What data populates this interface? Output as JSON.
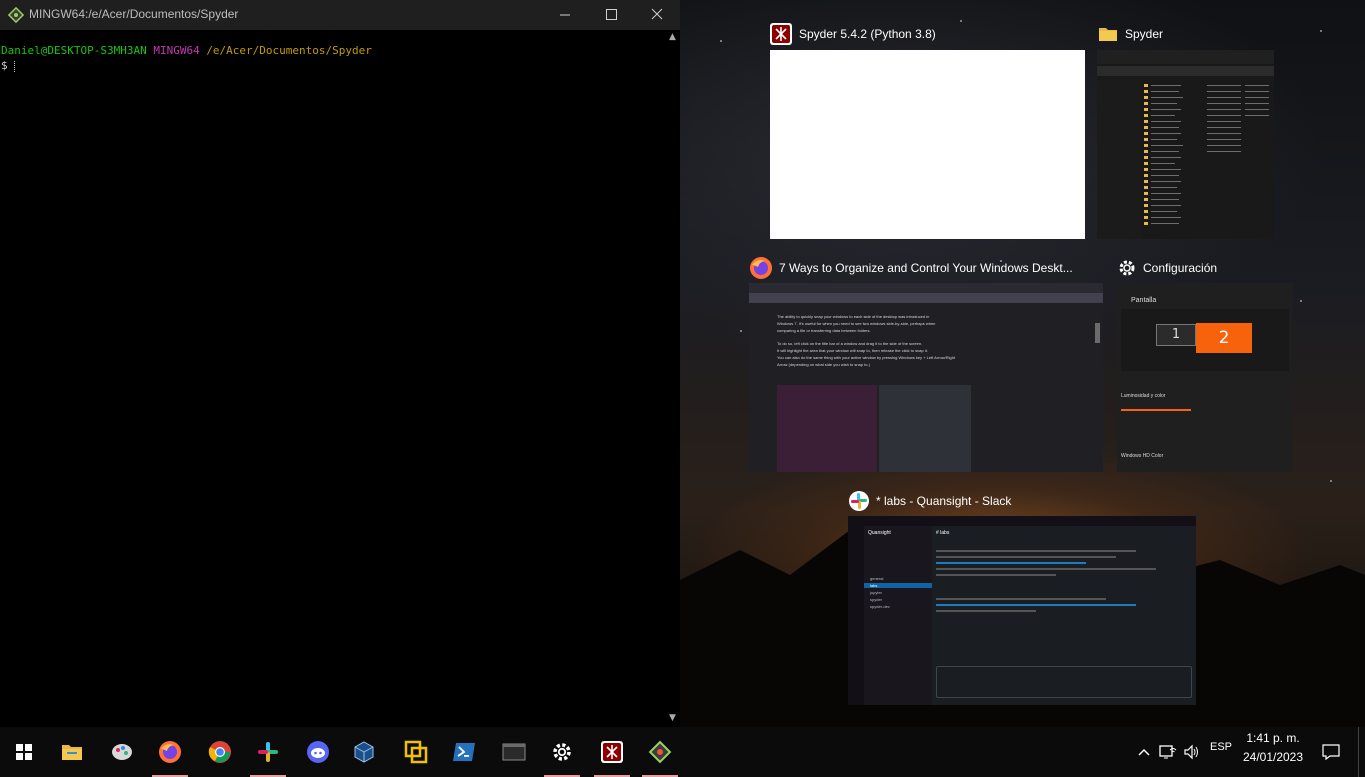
{
  "terminal": {
    "title": "MINGW64:/e/Acer/Documentos/Spyder",
    "user_host": "Daniel@DESKTOP-S3MH3AN",
    "shell": "MINGW64",
    "path": "/e/Acer/Documentos/Spyder",
    "prompt_symbol": "$"
  },
  "snap_windows": [
    {
      "title": "Spyder 5.4.2 (Python 3.8)",
      "icon": "spyder-icon"
    },
    {
      "title": "Spyder",
      "icon": "folder-icon"
    },
    {
      "title": "7 Ways to Organize and Control Your Windows Deskt...",
      "icon": "firefox-icon"
    },
    {
      "title": "Configuración",
      "icon": "gear-icon"
    },
    {
      "title": "* labs - Quansight - Slack",
      "icon": "slack-icon"
    }
  ],
  "settings_preview": {
    "display_label": "Pantalla",
    "monitor_1": "1",
    "monitor_2": "2",
    "brightness_heading": "Luminosidad y color",
    "hdr_heading": "Windows HD Color"
  },
  "firefox_preview": {
    "body_lines": [
      "The ability to quickly snap your windows to each side of the desktop was introduced in",
      "Windows 7. It's useful for when you need to see two windows side-by-side, perhaps when",
      "comparing a file or transferring data between folders.",
      "To do so, left click on the title bar of a window and drag it to the side of the screen.",
      "It will highlight the area that your window will snap to, then release the click to snap it.",
      "You can also do the same thing with your active window by pressing Windows key + Left Arrow/Right",
      "Arrow (depending on what side you wish to snap to.)"
    ]
  },
  "slack_preview": {
    "workspace": "Quansight",
    "channel": "# labs",
    "sidebar_items": [
      "general",
      "labs",
      "jupyter",
      "spyder",
      "spyder-dev"
    ]
  },
  "taskbar": {
    "apps": [
      "file-explorer-icon",
      "paint-icon",
      "firefox-icon",
      "chrome-icon",
      "slack-icon",
      "discord-icon",
      "virtualbox-icon",
      "vmware-icon",
      "powershell-icon",
      "terminal-window-icon",
      "settings-icon",
      "spyder-icon",
      "git-bash-icon"
    ],
    "language": "ESP",
    "time": "1:41 p. m.",
    "date": "24/01/2023"
  },
  "colors": {
    "prompt_user": "#16c60c",
    "prompt_shell": "#c239b3",
    "prompt_path": "#c19c00",
    "accent_orange": "#f7630c"
  }
}
